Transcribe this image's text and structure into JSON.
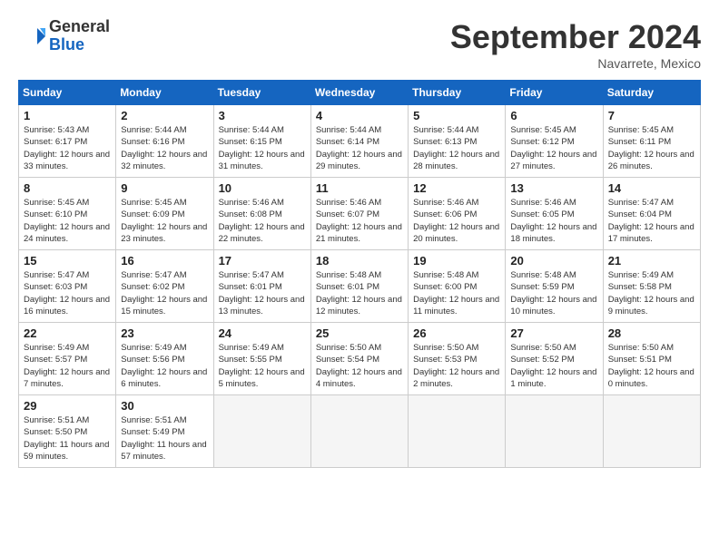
{
  "header": {
    "logo_general": "General",
    "logo_blue": "Blue",
    "month_title": "September 2024",
    "location": "Navarrete, Mexico"
  },
  "calendar": {
    "days_of_week": [
      "Sunday",
      "Monday",
      "Tuesday",
      "Wednesday",
      "Thursday",
      "Friday",
      "Saturday"
    ],
    "weeks": [
      [
        {
          "day": null
        },
        {
          "day": 2,
          "sunrise": "5:44 AM",
          "sunset": "6:16 PM",
          "daylight": "12 hours and 32 minutes."
        },
        {
          "day": 3,
          "sunrise": "5:44 AM",
          "sunset": "6:15 PM",
          "daylight": "12 hours and 31 minutes."
        },
        {
          "day": 4,
          "sunrise": "5:44 AM",
          "sunset": "6:14 PM",
          "daylight": "12 hours and 29 minutes."
        },
        {
          "day": 5,
          "sunrise": "5:44 AM",
          "sunset": "6:13 PM",
          "daylight": "12 hours and 28 minutes."
        },
        {
          "day": 6,
          "sunrise": "5:45 AM",
          "sunset": "6:12 PM",
          "daylight": "12 hours and 27 minutes."
        },
        {
          "day": 7,
          "sunrise": "5:45 AM",
          "sunset": "6:11 PM",
          "daylight": "12 hours and 26 minutes."
        }
      ],
      [
        {
          "day": 1,
          "sunrise": "5:43 AM",
          "sunset": "6:17 PM",
          "daylight": "12 hours and 33 minutes."
        },
        {
          "day": 8,
          "sunrise": "5:45 AM",
          "sunset": "6:10 PM",
          "daylight": "12 hours and 24 minutes."
        },
        {
          "day": 9,
          "sunrise": "5:45 AM",
          "sunset": "6:09 PM",
          "daylight": "12 hours and 23 minutes."
        },
        {
          "day": 10,
          "sunrise": "5:46 AM",
          "sunset": "6:08 PM",
          "daylight": "12 hours and 22 minutes."
        },
        {
          "day": 11,
          "sunrise": "5:46 AM",
          "sunset": "6:07 PM",
          "daylight": "12 hours and 21 minutes."
        },
        {
          "day": 12,
          "sunrise": "5:46 AM",
          "sunset": "6:06 PM",
          "daylight": "12 hours and 20 minutes."
        },
        {
          "day": 13,
          "sunrise": "5:46 AM",
          "sunset": "6:05 PM",
          "daylight": "12 hours and 18 minutes."
        }
      ],
      [
        {
          "day": 14,
          "sunrise": "5:47 AM",
          "sunset": "6:04 PM",
          "daylight": "12 hours and 17 minutes."
        },
        {
          "day": 15,
          "sunrise": "5:47 AM",
          "sunset": "6:03 PM",
          "daylight": "12 hours and 16 minutes."
        },
        {
          "day": 16,
          "sunrise": "5:47 AM",
          "sunset": "6:02 PM",
          "daylight": "12 hours and 15 minutes."
        },
        {
          "day": 17,
          "sunrise": "5:47 AM",
          "sunset": "6:01 PM",
          "daylight": "12 hours and 13 minutes."
        },
        {
          "day": 18,
          "sunrise": "5:48 AM",
          "sunset": "6:01 PM",
          "daylight": "12 hours and 12 minutes."
        },
        {
          "day": 19,
          "sunrise": "5:48 AM",
          "sunset": "6:00 PM",
          "daylight": "12 hours and 11 minutes."
        },
        {
          "day": 20,
          "sunrise": "5:48 AM",
          "sunset": "5:59 PM",
          "daylight": "12 hours and 10 minutes."
        }
      ],
      [
        {
          "day": 21,
          "sunrise": "5:49 AM",
          "sunset": "5:58 PM",
          "daylight": "12 hours and 9 minutes."
        },
        {
          "day": 22,
          "sunrise": "5:49 AM",
          "sunset": "5:57 PM",
          "daylight": "12 hours and 7 minutes."
        },
        {
          "day": 23,
          "sunrise": "5:49 AM",
          "sunset": "5:56 PM",
          "daylight": "12 hours and 6 minutes."
        },
        {
          "day": 24,
          "sunrise": "5:49 AM",
          "sunset": "5:55 PM",
          "daylight": "12 hours and 5 minutes."
        },
        {
          "day": 25,
          "sunrise": "5:50 AM",
          "sunset": "5:54 PM",
          "daylight": "12 hours and 4 minutes."
        },
        {
          "day": 26,
          "sunrise": "5:50 AM",
          "sunset": "5:53 PM",
          "daylight": "12 hours and 2 minutes."
        },
        {
          "day": 27,
          "sunrise": "5:50 AM",
          "sunset": "5:52 PM",
          "daylight": "12 hours and 1 minute."
        }
      ],
      [
        {
          "day": 28,
          "sunrise": "5:50 AM",
          "sunset": "5:51 PM",
          "daylight": "12 hours and 0 minutes."
        },
        {
          "day": 29,
          "sunrise": "5:51 AM",
          "sunset": "5:50 PM",
          "daylight": "11 hours and 59 minutes."
        },
        {
          "day": 30,
          "sunrise": "5:51 AM",
          "sunset": "5:49 PM",
          "daylight": "11 hours and 57 minutes."
        },
        {
          "day": null
        },
        {
          "day": null
        },
        {
          "day": null
        },
        {
          "day": null
        }
      ]
    ]
  }
}
